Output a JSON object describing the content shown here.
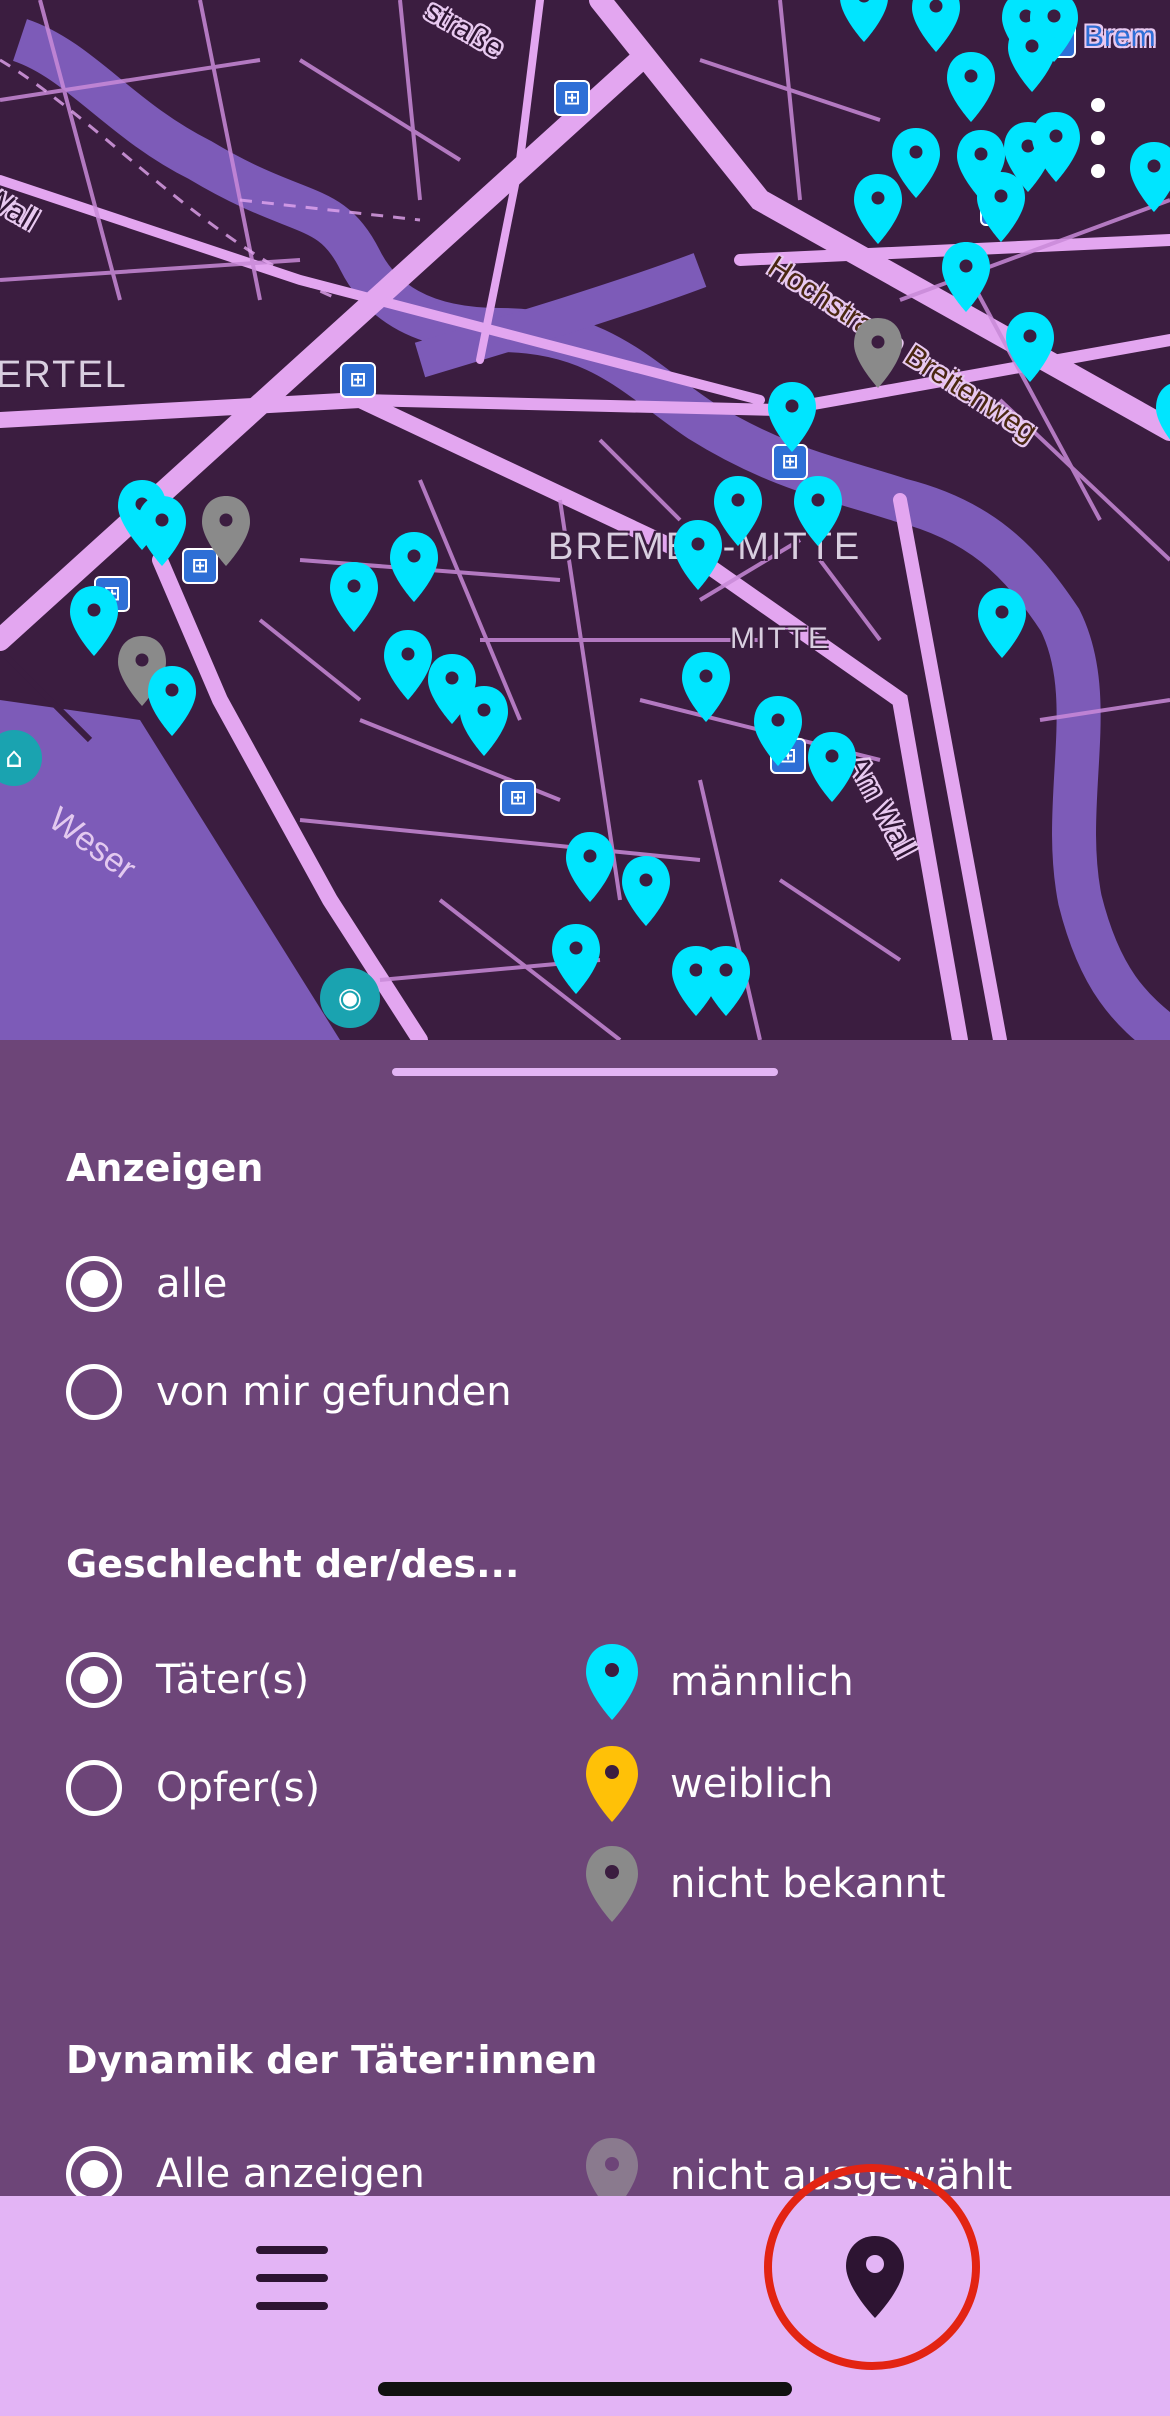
{
  "map": {
    "district_labels": [
      "ERTEL",
      "BREMEN-MITTE",
      "MITTE"
    ],
    "street_labels": [
      "Hochstraße Breitenweg",
      "Am Wall",
      "Wall",
      "straße",
      "Brem"
    ],
    "river_label": "Weser",
    "colors": {
      "background": "#3b1d40",
      "roads": "#e3a6f0",
      "water": "#7d5bb8",
      "pin_male": "#00e5ff",
      "pin_female": "#ffc107",
      "pin_unknown": "#8a8a8a"
    }
  },
  "sheet": {
    "show_section": {
      "title": "Anzeigen",
      "options": [
        {
          "label": "alle",
          "checked": true
        },
        {
          "label": "von mir gefunden",
          "checked": false
        }
      ]
    },
    "gender_section": {
      "title": "Geschlecht der/des...",
      "options": [
        {
          "label": "Täter(s)",
          "checked": true
        },
        {
          "label": "Opfer(s)",
          "checked": false
        }
      ],
      "legend": [
        {
          "label": "männlich",
          "color": "#00e5ff"
        },
        {
          "label": "weiblich",
          "color": "#ffc107"
        },
        {
          "label": "nicht bekannt",
          "color": "#8a8a8a"
        }
      ]
    },
    "dynamics_section": {
      "title": "Dynamik der Täter:innen",
      "options": [
        {
          "label": "Alle anzeigen",
          "checked": true
        }
      ],
      "legend": [
        {
          "label": "nicht ausgewählt",
          "color": "#8a7a8e"
        }
      ]
    }
  },
  "bottom_nav": {
    "menu_icon": "hamburger-menu-icon",
    "pin_icon": "map-pin-icon"
  }
}
